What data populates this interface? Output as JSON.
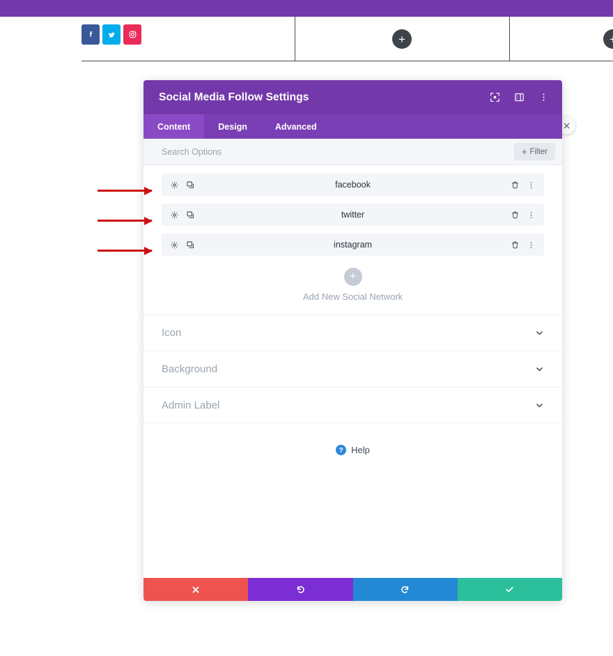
{
  "admin_bar": {
    "name": "wordpress-admin-bar"
  },
  "builder": {
    "social_icons": [
      {
        "network": "facebook",
        "icon": "facebook-icon",
        "color": "#3b5998"
      },
      {
        "network": "twitter",
        "icon": "twitter-icon",
        "color": "#00aced"
      },
      {
        "network": "instagram",
        "icon": "instagram-icon",
        "color": "#ea2c59"
      }
    ],
    "add_module_label": "+",
    "columns": [
      {
        "name": "column-one"
      },
      {
        "name": "column-two"
      },
      {
        "name": "column-three"
      }
    ]
  },
  "annotations": {
    "arrows": [
      {
        "target": "facebook-row"
      },
      {
        "target": "twitter-row"
      },
      {
        "target": "instagram-row"
      }
    ],
    "color": "#cc1111"
  },
  "modal": {
    "title": "Social Media Follow Settings",
    "header_icons": [
      {
        "name": "focus-target-icon"
      },
      {
        "name": "layout-panel-icon"
      },
      {
        "name": "more-vertical-icon"
      }
    ],
    "close_label": "×",
    "tabs": [
      {
        "label": "Content",
        "active": true
      },
      {
        "label": "Design",
        "active": false
      },
      {
        "label": "Advanced",
        "active": false
      }
    ],
    "search": {
      "placeholder": "Search Options",
      "value": ""
    },
    "filter": {
      "label": "Filter",
      "plus": "+"
    },
    "networks": [
      {
        "label": "facebook"
      },
      {
        "label": "twitter"
      },
      {
        "label": "instagram"
      }
    ],
    "add_network": {
      "plus": "+",
      "label": "Add New Social Network"
    },
    "sections": [
      {
        "label": "Icon"
      },
      {
        "label": "Background"
      },
      {
        "label": "Admin Label"
      }
    ],
    "help": {
      "glyph": "?",
      "label": "Help"
    },
    "actions": [
      {
        "name": "cancel",
        "icon": "close-icon",
        "color": "#ef5350"
      },
      {
        "name": "undo",
        "icon": "undo-icon",
        "color": "#7b2ed3"
      },
      {
        "name": "redo",
        "icon": "redo-icon",
        "color": "#2489d4"
      },
      {
        "name": "save",
        "icon": "check-icon",
        "color": "#2bbf9b"
      }
    ],
    "colors": {
      "header_purple": "#7339ab",
      "tab_bar_purple": "#7b3fb5",
      "tab_active_purple": "#8a4ac6"
    }
  }
}
